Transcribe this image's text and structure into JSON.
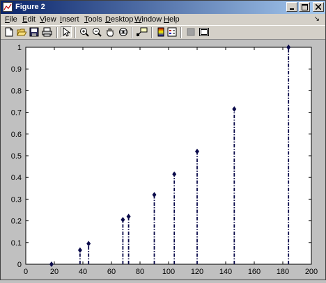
{
  "window": {
    "title": "Figure 2"
  },
  "menubar": {
    "items": [
      {
        "label": "File",
        "key": "F"
      },
      {
        "label": "Edit",
        "key": "E"
      },
      {
        "label": "View",
        "key": "V"
      },
      {
        "label": "Insert",
        "key": "I"
      },
      {
        "label": "Tools",
        "key": "T"
      },
      {
        "label": "Desktop",
        "key": "D"
      },
      {
        "label": "Window",
        "key": "W"
      },
      {
        "label": "Help",
        "key": "H"
      }
    ]
  },
  "toolbar": {
    "icons": [
      "new-figure-icon",
      "open-file-icon",
      "save-icon",
      "print-icon",
      "edit-plot-pointer-icon",
      "zoom-in-icon",
      "zoom-out-icon",
      "pan-hand-icon",
      "rotate-3d-icon",
      "data-cursor-icon",
      "insert-colorbar-icon",
      "insert-legend-icon",
      "hide-plot-tools-icon",
      "show-plot-tools-icon"
    ]
  },
  "colors": {
    "stem": "#0a0a4a",
    "title_start": "#0a246a",
    "title_end": "#a6caf0",
    "chrome": "#d4d0c8",
    "figure_bg": "#c0c0c0"
  },
  "chart_data": {
    "type": "stem",
    "x": [
      18,
      38,
      44,
      68,
      72,
      90,
      104,
      120,
      146,
      184
    ],
    "values": [
      0,
      0.065,
      0.095,
      0.205,
      0.22,
      0.32,
      0.415,
      0.52,
      0.715,
      1.0
    ],
    "line_style": "dash-dot",
    "marker": "filled-diamond",
    "xlim": [
      0,
      200
    ],
    "ylim": [
      0,
      1
    ],
    "xticks": [
      "0",
      "20",
      "40",
      "60",
      "80",
      "100",
      "120",
      "140",
      "160",
      "180",
      "200"
    ],
    "yticks": [
      "0",
      "0.1",
      "0.2",
      "0.3",
      "0.4",
      "0.5",
      "0.6",
      "0.7",
      "0.8",
      "0.9",
      "1"
    ],
    "title": "",
    "xlabel": "",
    "ylabel": "",
    "grid": false
  }
}
